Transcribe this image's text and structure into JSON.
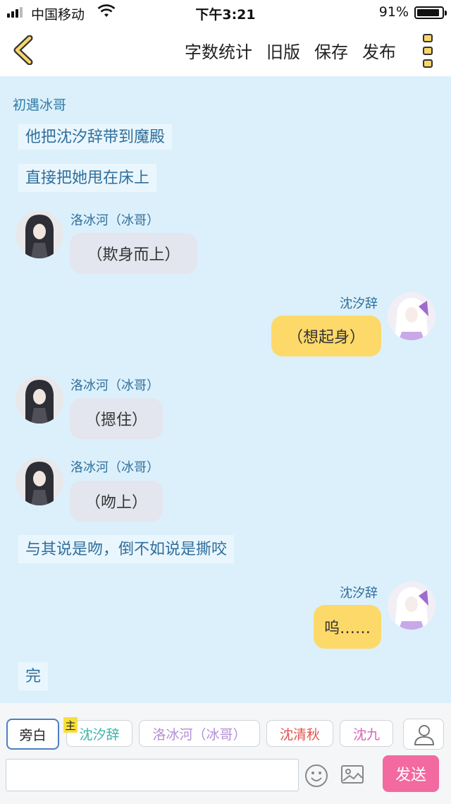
{
  "status_bar": {
    "carrier": "中国移动",
    "time": "下午3:21",
    "battery": "91%",
    "battery_level": 0.91
  },
  "nav": {
    "word_count": "字数统计",
    "old_version": "旧版",
    "save": "保存",
    "publish": "发布"
  },
  "story": {
    "title": "初遇冰哥"
  },
  "messages": {
    "m1": "他把沈汐辞带到魔殿",
    "m2": "直接把她甩在床上",
    "m3_speaker": "洛冰河（冰哥）",
    "m3_text": "（欺身而上）",
    "m4_speaker": "沈汐辞",
    "m4_text": "（想起身）",
    "m5_speaker": "洛冰河（冰哥）",
    "m5_text": "（摁住）",
    "m6_speaker": "洛冰河（冰哥）",
    "m6_text": "（吻上）",
    "m7": "与其说是吻，倒不如说是撕咬",
    "m8_speaker": "沈汐辞",
    "m8_text": "呜……",
    "m9": "完"
  },
  "roles": {
    "narrator": "旁白",
    "owner_badge": "主",
    "r1": "沈汐辞",
    "r2": "洛冰河（冰哥）",
    "r3": "沈清秋",
    "r4": "沈九",
    "r1_color": "#3fb4a8",
    "r2_color": "#b48fd6",
    "r3_color": "#e0554f",
    "r4_color": "#d765b5"
  },
  "input": {
    "value": "",
    "send": "发送"
  },
  "colors": {
    "accent_pink": "#f26aa0",
    "bubble_yellow": "#fdd96a",
    "bubble_grey": "#e3e6ee",
    "background": "#dcf0fb"
  }
}
